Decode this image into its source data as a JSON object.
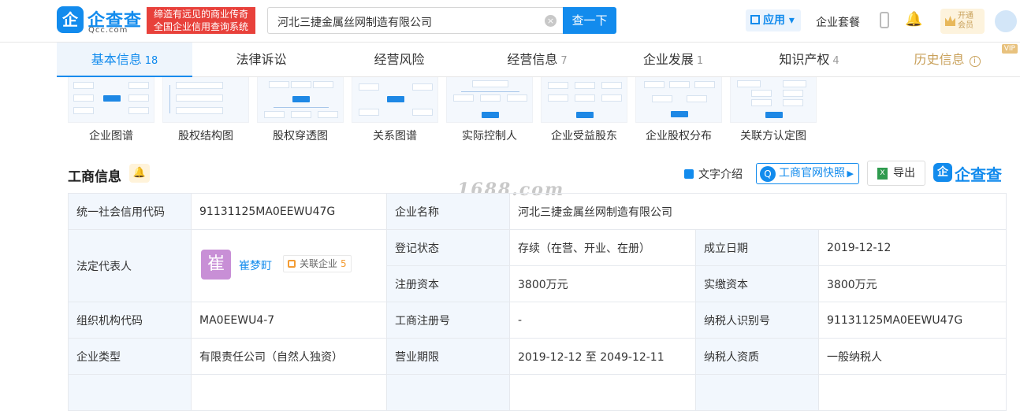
{
  "header": {
    "logo_mark": "企",
    "logo_text": "企查查",
    "logo_sub": "Qcc.com",
    "slogan_line1": "缔造有远见的商业传奇",
    "slogan_line2": "全国企业信用查询系统",
    "search_value": "河北三捷金属丝网制造有限公司",
    "search_button": "查一下",
    "apps_label": "应用",
    "suite_label": "企业套餐",
    "vip_line1": "开通",
    "vip_line2": "会员"
  },
  "tabs": [
    {
      "label": "基本信息",
      "count": "18"
    },
    {
      "label": "法律诉讼",
      "count": ""
    },
    {
      "label": "经营风险",
      "count": ""
    },
    {
      "label": "经营信息",
      "count": "7"
    },
    {
      "label": "企业发展",
      "count": "1"
    },
    {
      "label": "知识产权",
      "count": "4"
    },
    {
      "label": "历史信息",
      "count": "",
      "badge": "VIP"
    }
  ],
  "thumbnails": [
    {
      "label": "企业图谱"
    },
    {
      "label": "股权结构图"
    },
    {
      "label": "股权穿透图"
    },
    {
      "label": "关系图谱"
    },
    {
      "label": "实际控制人"
    },
    {
      "label": "企业受益股东"
    },
    {
      "label": "企业股权分布"
    },
    {
      "label": "关联方认定图"
    }
  ],
  "section": {
    "title": "工商信息",
    "intro_label": "文字介绍",
    "snapshot_label": "工商官网快照",
    "export_label": "导出",
    "brand_text": "企查查",
    "watermark": "1688.com"
  },
  "info": {
    "credit_code_label": "统一社会信用代码",
    "credit_code": "91131125MA0EEWU47G",
    "company_name_label": "企业名称",
    "company_name": "河北三捷金属丝网制造有限公司",
    "legal_rep_label": "法定代表人",
    "legal_rep_avatar": "崔",
    "legal_rep_name": "崔梦町",
    "related_label": "关联企业",
    "related_count": "5",
    "status_label": "登记状态",
    "status": "存续（在营、开业、在册）",
    "founded_label": "成立日期",
    "founded": "2019-12-12",
    "reg_capital_label": "注册资本",
    "reg_capital": "3800万元",
    "paid_capital_label": "实缴资本",
    "paid_capital": "3800万元",
    "org_code_label": "组织机构代码",
    "org_code": "MA0EEWU4-7",
    "reg_no_label": "工商注册号",
    "reg_no": "-",
    "tax_id_label": "纳税人识别号",
    "tax_id": "91131125MA0EEWU47G",
    "type_label": "企业类型",
    "type": "有限责任公司（自然人独资）",
    "term_label": "营业期限",
    "term": "2019-12-12 至 2049-12-11",
    "taxpayer_label": "纳税人资质",
    "taxpayer": "一般纳税人"
  }
}
